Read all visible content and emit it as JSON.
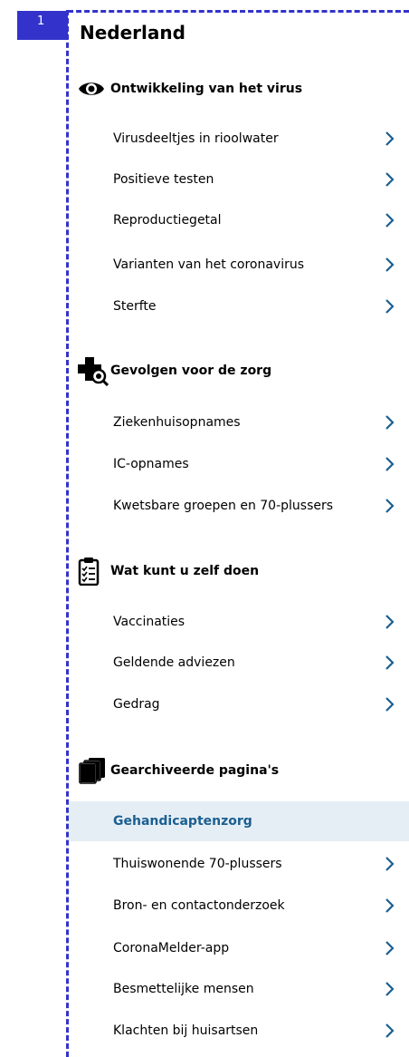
{
  "marker": "1",
  "country": "Nederland",
  "sections": [
    {
      "title": "Ontwikkeling van het virus",
      "icon": "eye-icon",
      "items": [
        "Virusdeeltjes in rioolwater",
        "Positieve testen",
        "Reproductiegetal",
        "Varianten van het coronavirus",
        "Sterfte"
      ]
    },
    {
      "title": "Gevolgen voor de zorg",
      "icon": "medical-cross-search-icon",
      "items": [
        "Ziekenhuisopnames",
        "IC-opnames",
        "Kwetsbare groepen en 70-plussers"
      ]
    },
    {
      "title": "Wat kunt u zelf doen",
      "icon": "clipboard-checklist-icon",
      "items": [
        "Vaccinaties",
        "Geldende adviezen",
        "Gedrag"
      ]
    },
    {
      "title": "Gearchiveerde pagina's",
      "icon": "archive-pages-icon",
      "items": [
        "Gehandicaptenzorg",
        "Thuiswonende 70-plussers",
        "Bron- en contactonderzoek",
        "CoronaMelder-app",
        "Besmettelijke mensen",
        "Klachten bij huisartsen"
      ]
    }
  ],
  "active_item": "Gehandicaptenzorg",
  "colors": {
    "marker": "#3333cc",
    "chevron": "#1a5f91",
    "active_bg": "#e6eef5",
    "active_text": "#1a5f91"
  }
}
